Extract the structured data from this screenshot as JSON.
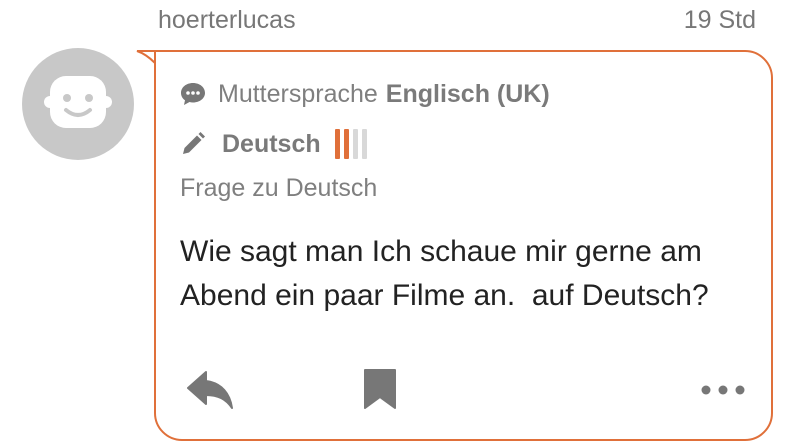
{
  "post": {
    "username": "hoerterlucas",
    "time": "19 Std",
    "native": {
      "label": "Muttersprache",
      "language": "Englisch (UK)"
    },
    "learning": {
      "language": "Deutsch",
      "level": 2,
      "level_max": 4
    },
    "question_type": "Frage zu Deutsch",
    "question_text": "Wie sagt man Ich schaue mir gerne am Abend ein paar Filme an.  auf Deutsch?"
  },
  "icons": {
    "avatar": "smiley-avatar-icon",
    "native": "speech-bubble-icon",
    "learning": "pencil-icon",
    "reply": "reply-icon",
    "bookmark": "bookmark-icon",
    "more": "more-dots-icon"
  },
  "colors": {
    "accent": "#e0703a",
    "level_inactive": "#d8d8d8",
    "icon_gray": "#777777",
    "avatar_bg": "#c8c8c8"
  }
}
